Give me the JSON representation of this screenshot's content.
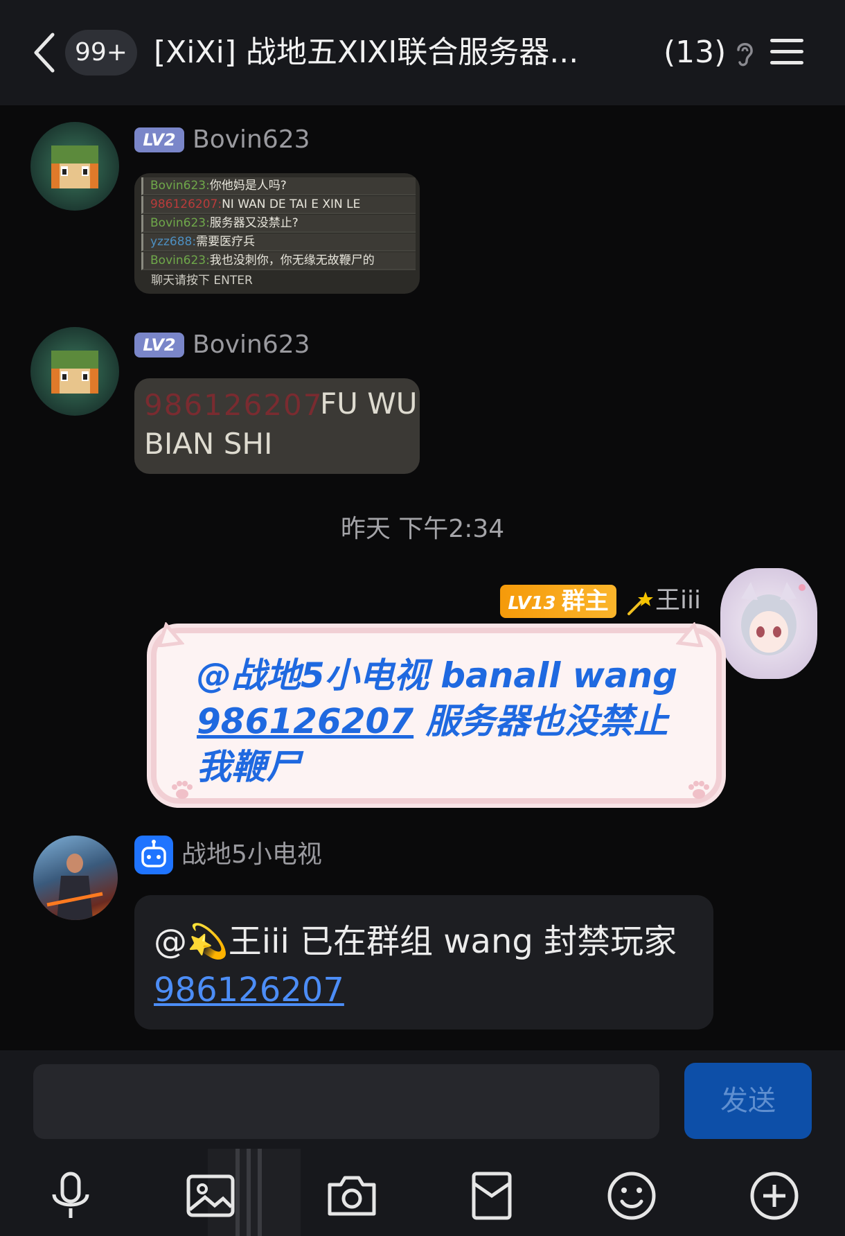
{
  "header": {
    "back_label": "",
    "unread_badge": "99+",
    "title": "[XiXi] 战地五XIXI联合服务器...",
    "member_count": "(13)",
    "icons": [
      "chevron-left-icon",
      "ear-icon",
      "menu-icon"
    ]
  },
  "messages": [
    {
      "sender": "Bovin623",
      "level": "LV2",
      "type": "image",
      "image_lines": [
        {
          "name": "Bovin623:",
          "text": "你他妈是人吗?"
        },
        {
          "name": "986126207:",
          "text": "NI WAN DE TAI E XIN LE"
        },
        {
          "name": "Bovin623:",
          "text": "服务器又没禁止?"
        },
        {
          "name": "yzz688:",
          "text": "需要医疗兵"
        },
        {
          "name": "Bovin623:",
          "text": "我也没刺你，你无缘无故鞭尸的"
        }
      ],
      "image_hint": "聊天请按下 ENTER"
    },
    {
      "sender": "Bovin623",
      "level": "LV2",
      "type": "image",
      "image_ghost": "986126207",
      "image_line1": "FU WU",
      "image_line2": "BIAN SHI"
    }
  ],
  "timestamp": "昨天 下午2:34",
  "owner_message": {
    "level": "LV13",
    "role": "群主",
    "sender": "王iii",
    "text_part1": "@战地5小电视 banall wang ",
    "text_link": "986126207",
    "text_part2": " 服务器也没禁止我鞭尸"
  },
  "bot_message": {
    "sender": "战地5小电视",
    "text_prefix": "@💫王iii 已在群组 wang 封禁玩家 ",
    "text_link": "986126207"
  },
  "input": {
    "placeholder": "",
    "value": "",
    "send_label": "发送"
  },
  "toolbar": [
    "microphone-icon",
    "image-icon",
    "camera-icon",
    "red-packet-icon",
    "emoji-icon",
    "plus-icon"
  ],
  "colors": {
    "background": "#0a0a0b",
    "header": "#17181c",
    "accent_blue": "#1f74ff",
    "link": "#4c8df6",
    "owner_badge": "#f59a0a",
    "send_button": "#0d4fa8"
  }
}
